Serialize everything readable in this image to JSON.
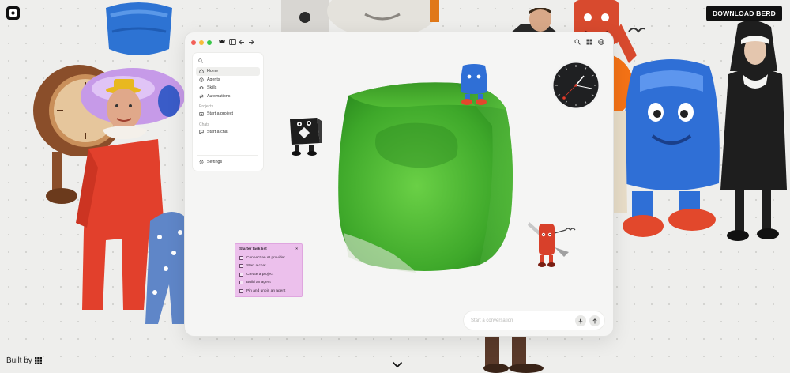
{
  "header": {
    "download_label": "DOWNLOAD BERD"
  },
  "footer": {
    "built_by_label": "Built by"
  },
  "app": {
    "sidebar": {
      "items": [
        {
          "label": "Home",
          "icon": "home-icon",
          "active": true
        },
        {
          "label": "Agents",
          "icon": "agents-icon"
        },
        {
          "label": "Skills",
          "icon": "skills-icon"
        },
        {
          "label": "Automations",
          "icon": "automations-icon"
        }
      ],
      "projects_heading": "Projects",
      "start_project_label": "Start a project",
      "chats_heading": "Chats",
      "start_chat_label": "Start a chat",
      "settings_label": "Settings"
    },
    "task_list": {
      "title": "Starter task list",
      "close_glyph": "×",
      "items": [
        "Connect an AI provider",
        "Start a chat",
        "Create a project",
        "Build an agent",
        "Pin and unpin an agent"
      ]
    },
    "composer": {
      "placeholder": "Start a conversation"
    }
  },
  "colors": {
    "background": "#eeeeec",
    "cube_green": "#4bb832",
    "task_card": "#ecc0ec",
    "clown_red": "#e2402c",
    "jelly_blue": "#2f6fd6"
  }
}
